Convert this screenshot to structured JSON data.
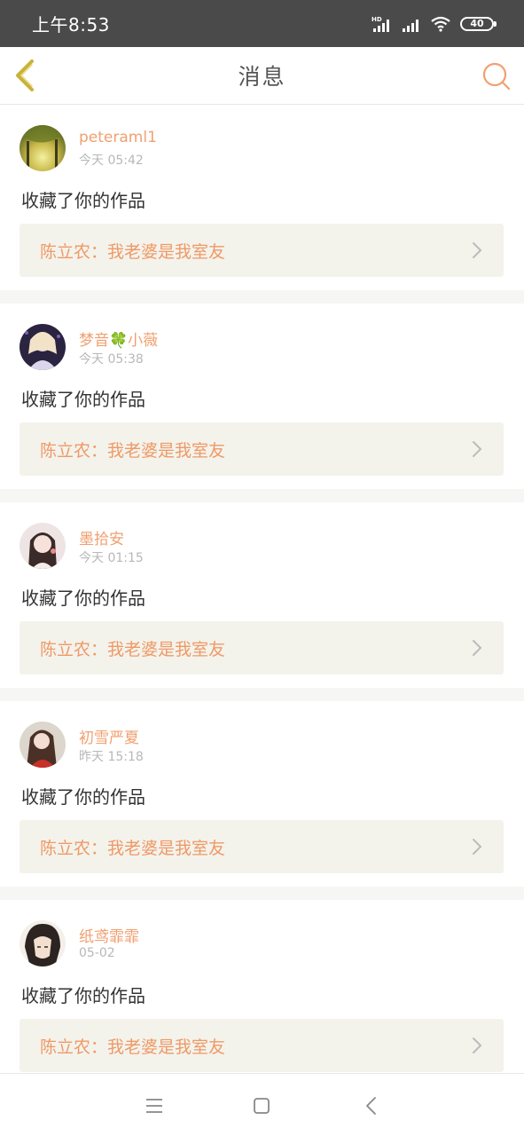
{
  "status_bar": {
    "time": "上午8:53",
    "battery": "40",
    "icons": [
      "hd-signal-icon",
      "signal-icon",
      "wifi-icon",
      "battery-icon"
    ]
  },
  "header": {
    "title": "消息",
    "back_icon": "chevron-left-icon",
    "search_icon": "search-icon"
  },
  "colors": {
    "accent": "#f09966",
    "username": "#f0a070",
    "back_arrow": "#c9b23a",
    "link_bg": "#f3f3ec"
  },
  "messages": [
    {
      "username": "peteraml1",
      "time": "今天 05:42",
      "action": "收藏了你的作品",
      "work": "陈立农：我老婆是我室友"
    },
    {
      "username": "梦音🍀小薇",
      "time": "今天 05:38",
      "action": "收藏了你的作品",
      "work": "陈立农：我老婆是我室友"
    },
    {
      "username": "墨拾安",
      "time": "今天 01:15",
      "action": "收藏了你的作品",
      "work": "陈立农：我老婆是我室友"
    },
    {
      "username": "初雪严夏",
      "time": "昨天 15:18",
      "action": "收藏了你的作品",
      "work": "陈立农：我老婆是我室友"
    },
    {
      "username": "纸鸢霏霏",
      "time": "05-02",
      "action": "收藏了你的作品",
      "work": "陈立农：我老婆是我室友"
    }
  ],
  "nav_bar": {
    "icons": [
      "menu-icon",
      "home-square-icon",
      "back-triangle-icon"
    ]
  }
}
